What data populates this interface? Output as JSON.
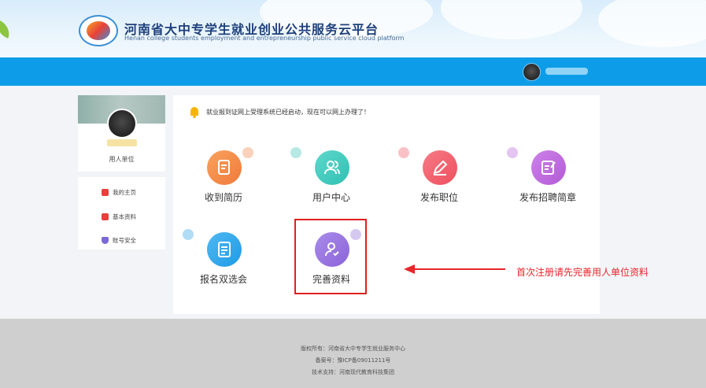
{
  "header": {
    "title": "河南省大中专学生就业创业公共服务云平台",
    "subtitle": "Henan college students employment and entrepreneurship public service cloud platform",
    "colors": {
      "banner": "#0d9de8",
      "title": "#1d3f7a"
    }
  },
  "profile": {
    "role": "用人单位"
  },
  "side_menu": {
    "items": [
      {
        "label": "我的主页",
        "icon": "home-icon",
        "color": "#e8413a"
      },
      {
        "label": "基本资料",
        "icon": "document-icon",
        "color": "#e8413a"
      },
      {
        "label": "账号安全",
        "icon": "shield-icon",
        "color": "#7b68d9"
      }
    ]
  },
  "notice": {
    "text": "就业报到证网上受理系统已经启动，现在可以网上办理了！",
    "icon": "bell-icon"
  },
  "tiles": [
    {
      "label": "收到简历",
      "icon": "resume-icon",
      "color": "#f07a3a"
    },
    {
      "label": "用户中心",
      "icon": "users-icon",
      "color": "#2ec0b3"
    },
    {
      "label": "发布职位",
      "icon": "edit-icon",
      "color": "#ef4f5e"
    },
    {
      "label": "发布招聘简章",
      "icon": "write-icon",
      "color": "#b35ad6"
    },
    {
      "label": "报名双选会",
      "icon": "list-icon",
      "color": "#1f9be5"
    },
    {
      "label": "完善资料",
      "icon": "user-check-icon",
      "color": "#8a63d8"
    }
  ],
  "annotation": {
    "text": "首次注册请先完善用人单位资料",
    "color": "#e8262c"
  },
  "footer": {
    "copyright": "版权所有：河南省大中专学生就业服务中心",
    "icp": "备案号：豫ICP备09011211号",
    "support": "技术支持：河南现代教育科技集团"
  }
}
